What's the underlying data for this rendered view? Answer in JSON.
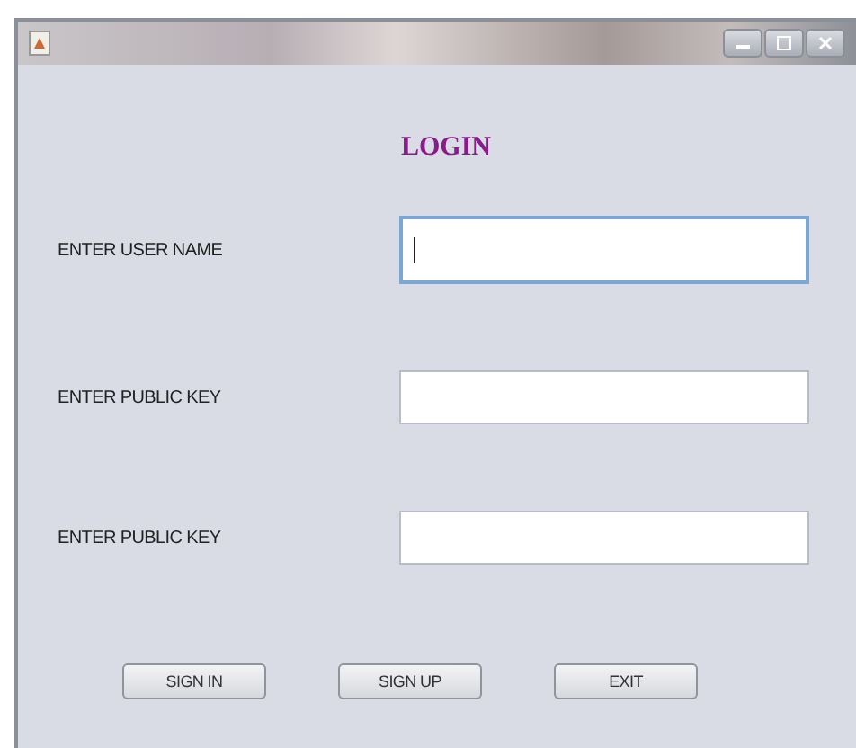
{
  "heading": "LOGIN",
  "fields": [
    {
      "label": "ENTER USER NAME",
      "focused": true
    },
    {
      "label": "ENTER PUBLIC KEY",
      "focused": false
    },
    {
      "label": "ENTER PUBLIC KEY",
      "focused": false
    }
  ],
  "buttons": [
    "SIGN IN",
    "SIGN UP",
    "EXIT"
  ]
}
